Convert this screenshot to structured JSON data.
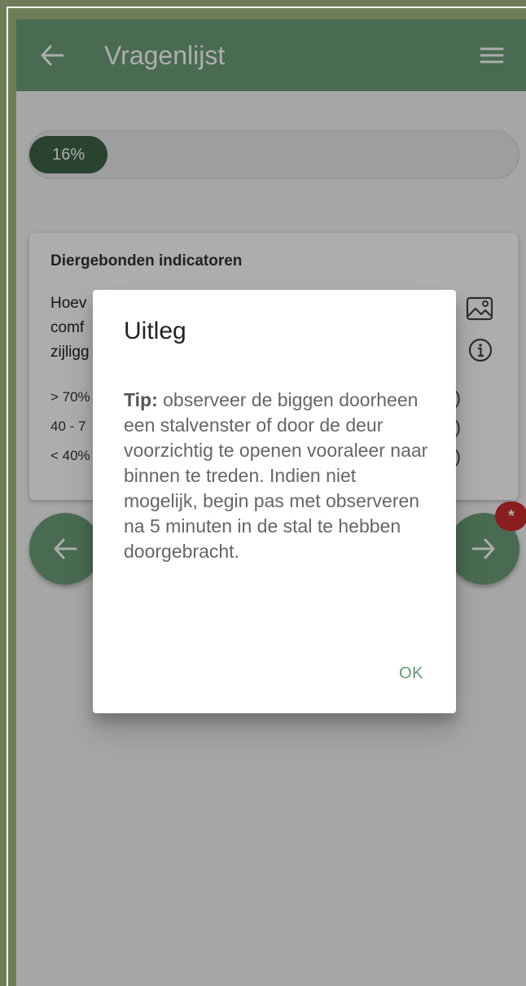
{
  "appbar": {
    "title": "Vragenlijst",
    "back_icon": "arrow-left-icon",
    "menu_icon": "hamburger-menu-icon"
  },
  "progress": {
    "label": "16%",
    "value": 0.16
  },
  "card": {
    "section_title": "Diergebonden indicatoren",
    "question_lines": [
      "Hoev",
      "comf",
      "zijligg"
    ],
    "options": [
      "> 70%",
      "40 - 7",
      "< 40%"
    ],
    "image_icon": "image-icon",
    "info_icon": "info-icon"
  },
  "nav": {
    "prev_icon": "arrow-left-icon",
    "next_icon": "arrow-right-icon",
    "badge": "*"
  },
  "dialog": {
    "title": "Uitleg",
    "tip_label": "Tip:",
    "tip_text": " observeer de biggen doorheen een stalvenster of door de deur voorzichtig te openen vooraleer naar binnen te treden. Indien niet mogelijk, begin pas met observeren na 5 minuten in de stal te hebben doorgebracht.",
    "ok_label": "OK"
  },
  "colors": {
    "appbar": "#6a9e78",
    "progress_fill": "#3f6446",
    "badge": "#cc2b2b",
    "ok": "#5f9b6e"
  }
}
